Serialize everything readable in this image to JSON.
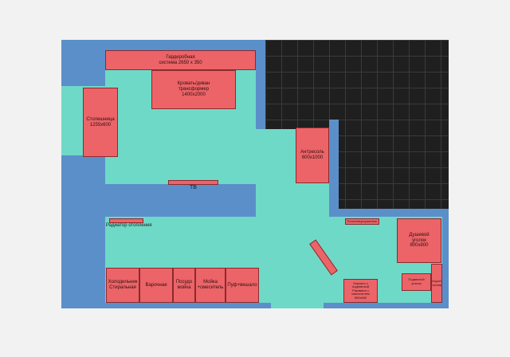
{
  "colors": {
    "wall": "#5b8fc9",
    "floor": "#6fd9c7",
    "furniture": "#ec6468",
    "tile": "#1f1f1f"
  },
  "plan": {
    "wardrobe": "Гардеробная\nсистема 2650 x 350",
    "bed": "Кровать/диван\nтрансформер\n1400x2000",
    "counter": "Столешница\n1255x600",
    "mezzanine": "Антресоль\n600x1000",
    "tv": "ТВ",
    "radiator": "Радиатор отопления",
    "fridge": "Холодильник\nСтиральная",
    "hob": "Варочная",
    "dishwasher": "Посудо\nмойка",
    "sink": "Мойка\n+смеситель",
    "pouf": "Пуф+вешало",
    "towel_rail": "Полотенцесушитель",
    "shower": "Душевой\nуголок\n800x800",
    "mirror": "Зеркало с\nподсветкой\nРаковина с\nсмесителем\n600x600",
    "wall_toilet": "Подвесной\nунитаз",
    "installation": "Короб\nинсталляции"
  }
}
